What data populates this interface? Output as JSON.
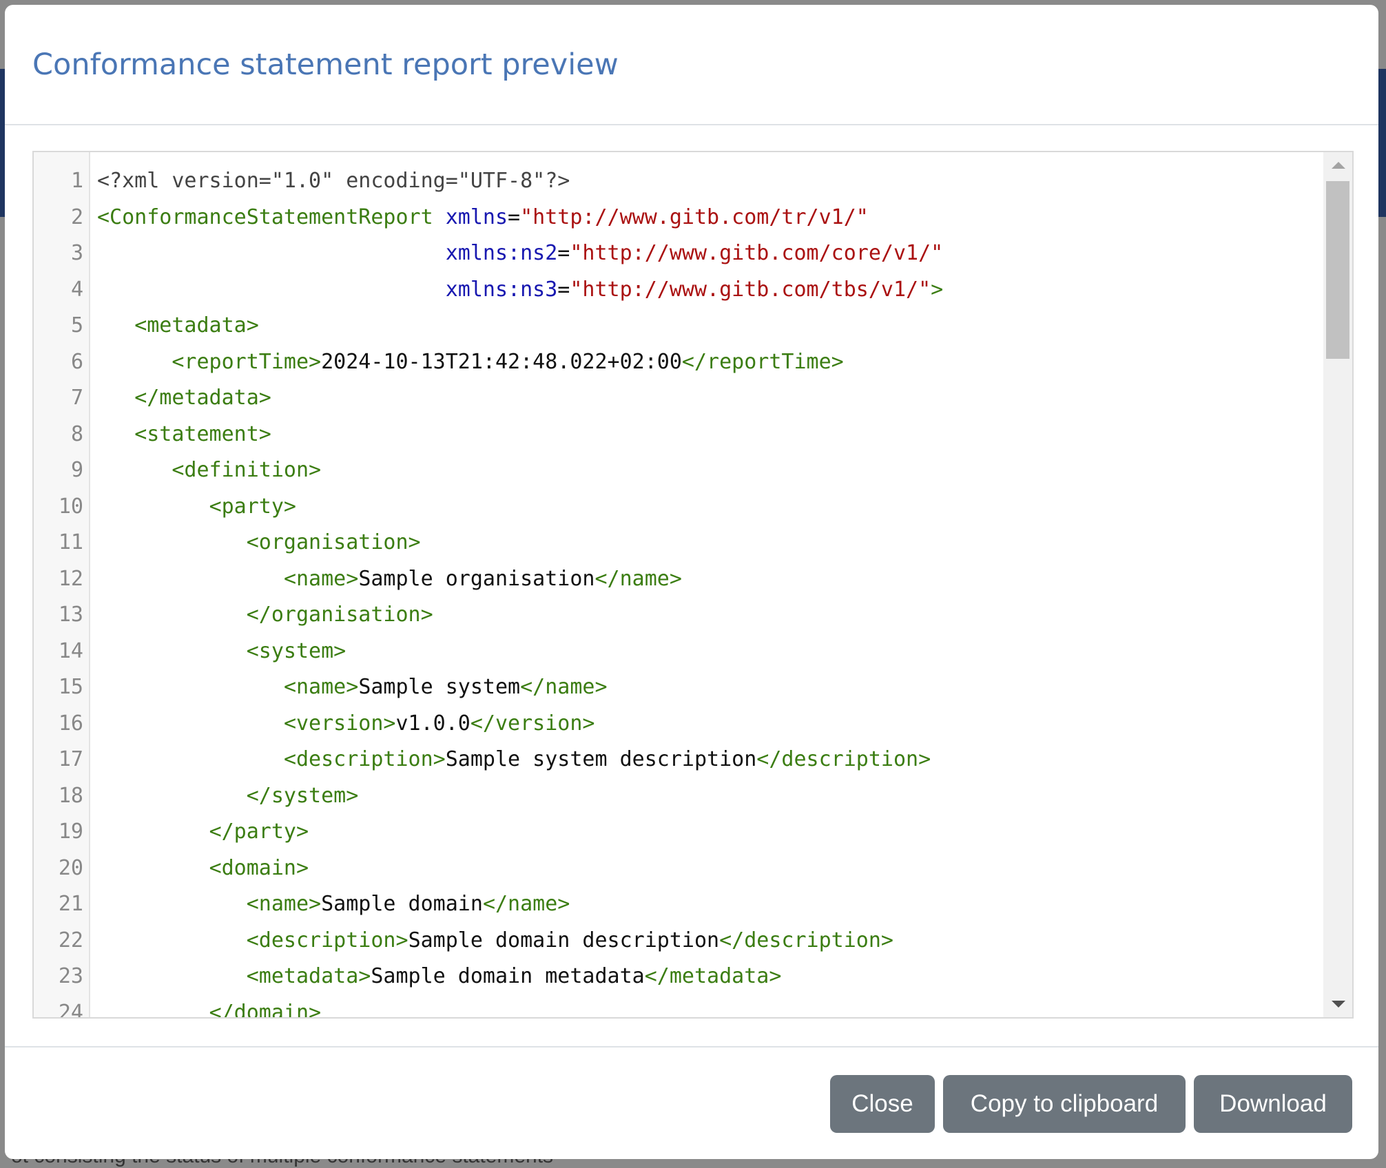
{
  "backdrop": {
    "partial_text": "ot   consisting the status of multiple conformance statements"
  },
  "modal": {
    "title": "Conformance statement report preview"
  },
  "editor": {
    "lines": [
      {
        "n": "1",
        "indent": "",
        "parts": [
          {
            "c": "decl",
            "t": "<?xml version=\"1.0\" encoding=\"UTF-8\"?>"
          }
        ]
      },
      {
        "n": "2",
        "indent": "",
        "parts": [
          {
            "c": "tag",
            "t": "<ConformanceStatementReport "
          },
          {
            "c": "attr",
            "t": "xmlns"
          },
          {
            "c": "text",
            "t": "="
          },
          {
            "c": "val",
            "t": "\"http://www.gitb.com/tr/v1/\""
          }
        ]
      },
      {
        "n": "3",
        "indent": "                            ",
        "parts": [
          {
            "c": "attr",
            "t": "xmlns:ns2"
          },
          {
            "c": "text",
            "t": "="
          },
          {
            "c": "val",
            "t": "\"http://www.gitb.com/core/v1/\""
          }
        ]
      },
      {
        "n": "4",
        "indent": "                            ",
        "parts": [
          {
            "c": "attr",
            "t": "xmlns:ns3"
          },
          {
            "c": "text",
            "t": "="
          },
          {
            "c": "val",
            "t": "\"http://www.gitb.com/tbs/v1/\""
          },
          {
            "c": "tag",
            "t": ">"
          }
        ]
      },
      {
        "n": "5",
        "indent": "   ",
        "parts": [
          {
            "c": "tag",
            "t": "<metadata>"
          }
        ]
      },
      {
        "n": "6",
        "indent": "      ",
        "parts": [
          {
            "c": "tag",
            "t": "<reportTime>"
          },
          {
            "c": "text",
            "t": "2024-10-13T21:42:48.022+02:00"
          },
          {
            "c": "tag",
            "t": "</reportTime>"
          }
        ]
      },
      {
        "n": "7",
        "indent": "   ",
        "parts": [
          {
            "c": "tag",
            "t": "</metadata>"
          }
        ]
      },
      {
        "n": "8",
        "indent": "   ",
        "parts": [
          {
            "c": "tag",
            "t": "<statement>"
          }
        ]
      },
      {
        "n": "9",
        "indent": "      ",
        "parts": [
          {
            "c": "tag",
            "t": "<definition>"
          }
        ]
      },
      {
        "n": "10",
        "indent": "         ",
        "parts": [
          {
            "c": "tag",
            "t": "<party>"
          }
        ]
      },
      {
        "n": "11",
        "indent": "            ",
        "parts": [
          {
            "c": "tag",
            "t": "<organisation>"
          }
        ]
      },
      {
        "n": "12",
        "indent": "               ",
        "parts": [
          {
            "c": "tag",
            "t": "<name>"
          },
          {
            "c": "text",
            "t": "Sample organisation"
          },
          {
            "c": "tag",
            "t": "</name>"
          }
        ]
      },
      {
        "n": "13",
        "indent": "            ",
        "parts": [
          {
            "c": "tag",
            "t": "</organisation>"
          }
        ]
      },
      {
        "n": "14",
        "indent": "            ",
        "parts": [
          {
            "c": "tag",
            "t": "<system>"
          }
        ]
      },
      {
        "n": "15",
        "indent": "               ",
        "parts": [
          {
            "c": "tag",
            "t": "<name>"
          },
          {
            "c": "text",
            "t": "Sample system"
          },
          {
            "c": "tag",
            "t": "</name>"
          }
        ]
      },
      {
        "n": "16",
        "indent": "               ",
        "parts": [
          {
            "c": "tag",
            "t": "<version>"
          },
          {
            "c": "text",
            "t": "v1.0.0"
          },
          {
            "c": "tag",
            "t": "</version>"
          }
        ]
      },
      {
        "n": "17",
        "indent": "               ",
        "parts": [
          {
            "c": "tag",
            "t": "<description>"
          },
          {
            "c": "text",
            "t": "Sample system description"
          },
          {
            "c": "tag",
            "t": "</description>"
          }
        ]
      },
      {
        "n": "18",
        "indent": "            ",
        "parts": [
          {
            "c": "tag",
            "t": "</system>"
          }
        ]
      },
      {
        "n": "19",
        "indent": "         ",
        "parts": [
          {
            "c": "tag",
            "t": "</party>"
          }
        ]
      },
      {
        "n": "20",
        "indent": "         ",
        "parts": [
          {
            "c": "tag",
            "t": "<domain>"
          }
        ]
      },
      {
        "n": "21",
        "indent": "            ",
        "parts": [
          {
            "c": "tag",
            "t": "<name>"
          },
          {
            "c": "text",
            "t": "Sample domain"
          },
          {
            "c": "tag",
            "t": "</name>"
          }
        ]
      },
      {
        "n": "22",
        "indent": "            ",
        "parts": [
          {
            "c": "tag",
            "t": "<description>"
          },
          {
            "c": "text",
            "t": "Sample domain description"
          },
          {
            "c": "tag",
            "t": "</description>"
          }
        ]
      },
      {
        "n": "23",
        "indent": "            ",
        "parts": [
          {
            "c": "tag",
            "t": "<metadata>"
          },
          {
            "c": "text",
            "t": "Sample domain metadata"
          },
          {
            "c": "tag",
            "t": "</metadata>"
          }
        ]
      },
      {
        "n": "24",
        "indent": "         ",
        "parts": [
          {
            "c": "tag",
            "t": "</domain>"
          }
        ]
      }
    ],
    "scroll_icons": {
      "up": "scroll-up-arrow-icon",
      "down": "scroll-down-arrow-icon"
    }
  },
  "footer": {
    "close_label": "Close",
    "copy_label": "Copy to clipboard",
    "download_label": "Download"
  },
  "colors": {
    "title": "#4a76b5",
    "button": "#6c757d",
    "xml_tag": "#3b7d12",
    "xml_attr": "#1818b0",
    "xml_value": "#a11111"
  }
}
